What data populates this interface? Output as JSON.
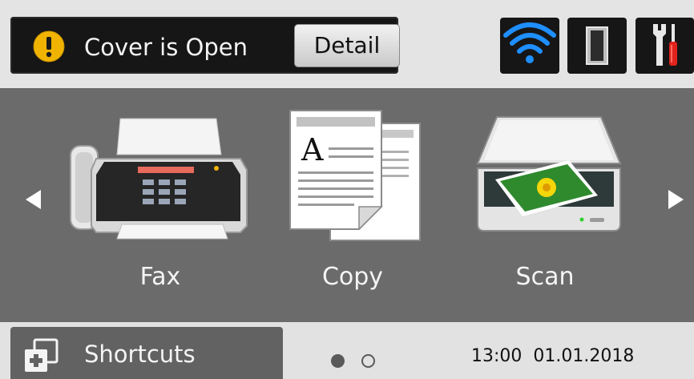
{
  "status": {
    "message": "Cover is Open",
    "detail_label": "Detail",
    "icons": [
      "warning-icon",
      "wifi-icon",
      "ink-toner-icon",
      "settings-tools-icon"
    ]
  },
  "functions": [
    {
      "label": "Fax",
      "icon": "fax-icon"
    },
    {
      "label": "Copy",
      "icon": "copy-icon"
    },
    {
      "label": "Scan",
      "icon": "scan-icon"
    }
  ],
  "bottom": {
    "shortcuts_label": "Shortcuts",
    "time": "13:00",
    "date": "01.01.2018",
    "pages": {
      "current": 1,
      "total": 2
    }
  },
  "colors": {
    "warning": "#f0b400",
    "wifi": "#1f8fff",
    "panel": "#6b6b6b",
    "tile": "#161616"
  }
}
